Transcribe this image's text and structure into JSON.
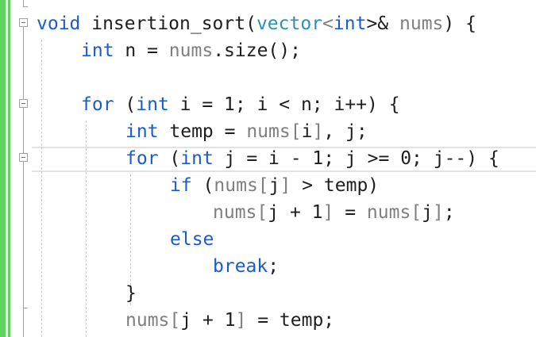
{
  "colors": {
    "keyword": "#1a5bcc",
    "type": "#2b91af",
    "identifier": "#1e1e1e",
    "parameter": "#7f7f7f",
    "change_bar": "#5fd35f"
  },
  "code_lines": [
    {
      "tokens": [
        {
          "t": "void",
          "c": "kw"
        },
        {
          "t": " insertion_sort(",
          "c": ""
        },
        {
          "t": "vector",
          "c": "ty"
        },
        {
          "t": "<",
          "c": "gr"
        },
        {
          "t": "int",
          "c": "kw"
        },
        {
          "t": ">&",
          "c": ""
        },
        {
          "t": " ",
          "c": ""
        },
        {
          "t": "nums",
          "c": "gr"
        },
        {
          "t": ") {",
          "c": ""
        }
      ]
    },
    {
      "tokens": [
        {
          "t": "int",
          "c": "kw"
        },
        {
          "t": " n = ",
          "c": ""
        },
        {
          "t": "nums",
          "c": "gr"
        },
        {
          "t": ".size();",
          "c": ""
        }
      ]
    },
    {
      "tokens": []
    },
    {
      "tokens": [
        {
          "t": "for",
          "c": "kw"
        },
        {
          "t": " (",
          "c": ""
        },
        {
          "t": "int",
          "c": "kw"
        },
        {
          "t": " i = 1; i < n; i++) {",
          "c": ""
        }
      ]
    },
    {
      "tokens": [
        {
          "t": "int",
          "c": "kw"
        },
        {
          "t": " temp = ",
          "c": ""
        },
        {
          "t": "nums[",
          "c": "gr"
        },
        {
          "t": "i",
          "c": ""
        },
        {
          "t": "]",
          "c": "gr"
        },
        {
          "t": ", j;",
          "c": ""
        }
      ]
    },
    {
      "tokens": [
        {
          "t": "for",
          "c": "kw"
        },
        {
          "t": " (",
          "c": ""
        },
        {
          "t": "int",
          "c": "kw"
        },
        {
          "t": " j = i - 1; j >= 0; j--) {",
          "c": ""
        }
      ]
    },
    {
      "tokens": [
        {
          "t": "if",
          "c": "kw"
        },
        {
          "t": " (",
          "c": ""
        },
        {
          "t": "nums[",
          "c": "gr"
        },
        {
          "t": "j",
          "c": ""
        },
        {
          "t": "]",
          "c": "gr"
        },
        {
          "t": " > temp)",
          "c": ""
        }
      ]
    },
    {
      "tokens": [
        {
          "t": "nums[",
          "c": "gr"
        },
        {
          "t": "j + 1",
          "c": ""
        },
        {
          "t": "]",
          "c": "gr"
        },
        {
          "t": " = ",
          "c": ""
        },
        {
          "t": "nums[",
          "c": "gr"
        },
        {
          "t": "j",
          "c": ""
        },
        {
          "t": "]",
          "c": "gr"
        },
        {
          "t": ";",
          "c": ""
        }
      ]
    },
    {
      "tokens": [
        {
          "t": "else",
          "c": "kw"
        }
      ]
    },
    {
      "tokens": [
        {
          "t": "break",
          "c": "kw"
        },
        {
          "t": ";",
          "c": ""
        }
      ]
    },
    {
      "tokens": [
        {
          "t": "}",
          "c": ""
        }
      ]
    },
    {
      "tokens": [
        {
          "t": "nums[",
          "c": "gr"
        },
        {
          "t": "j + 1",
          "c": ""
        },
        {
          "t": "]",
          "c": "gr"
        },
        {
          "t": " = temp;",
          "c": ""
        }
      ]
    }
  ]
}
